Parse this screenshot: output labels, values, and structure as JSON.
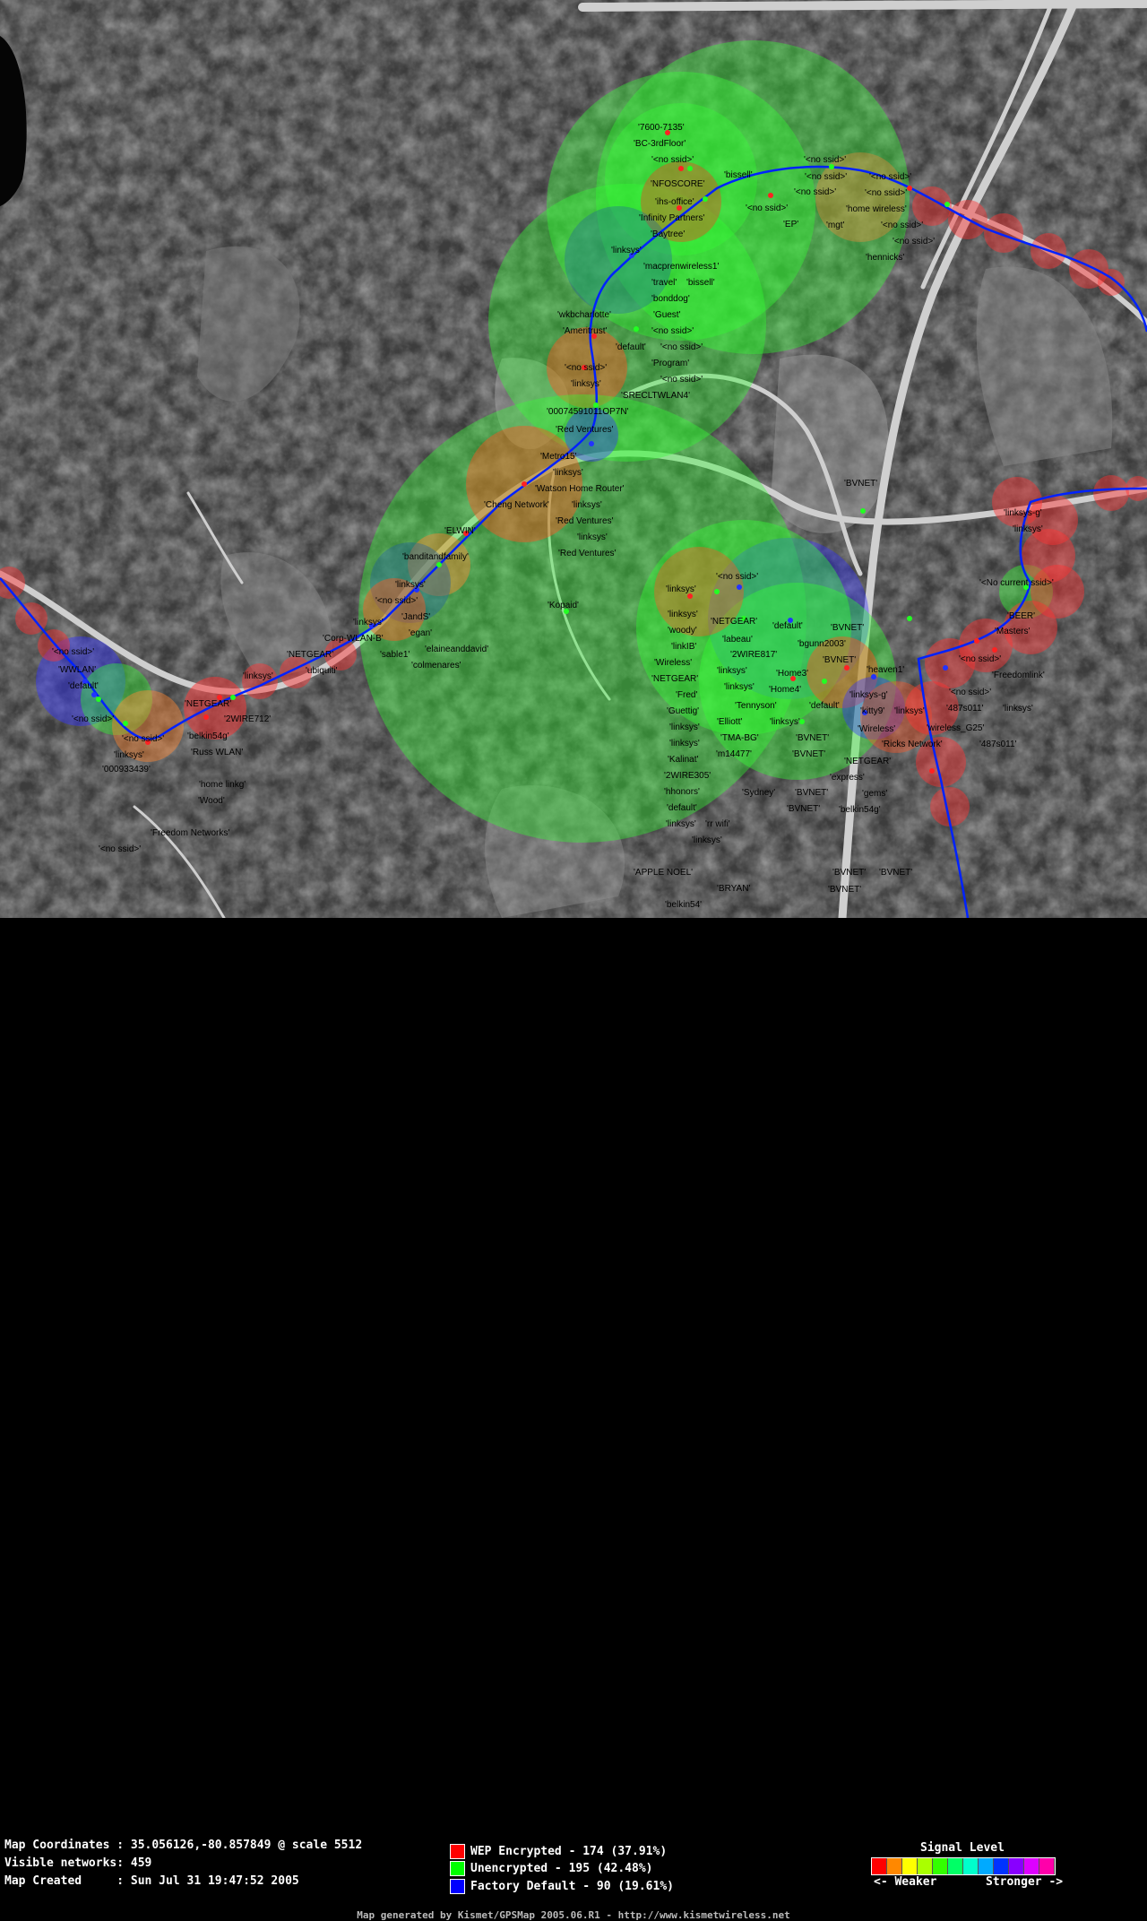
{
  "info": {
    "coordinates_label": "Map Coordinates : 35.056126,-80.857849 @ scale 5512",
    "visible_label": "Visible networks: 459",
    "created_label": "Map Created     : Sun Jul 31 19:47:52 2005"
  },
  "legend": {
    "wep": {
      "label": "WEP Encrypted - 174 (37.91%)",
      "color": "#ff0000"
    },
    "unencrypted": {
      "label": "Unencrypted - 195 (42.48%)",
      "color": "#00ff00"
    },
    "factory": {
      "label": "Factory Default - 90 (19.61%)",
      "color": "#0000ff"
    }
  },
  "signal": {
    "title": "Signal Level",
    "weaker": "<- Weaker",
    "stronger": "Stronger ->",
    "colors": [
      "#ff0000",
      "#ff8800",
      "#ffff00",
      "#aaff00",
      "#33ff00",
      "#00ff66",
      "#00ffcc",
      "#00aaff",
      "#0033ff",
      "#8800ff",
      "#dd00ff",
      "#ff00aa"
    ]
  },
  "credit": "Map generated by Kismet/GPSMap 2005.06.R1 - http://www.kismetwireless.net",
  "map": {
    "track_color": "#0022ff",
    "labels": [
      "'7600-7135'",
      "'BC-3rdFloor'",
      "'<no ssid>'",
      "'bissell'",
      "'<no ssid>'",
      "'<no ssid>'",
      "'NFOSCORE'",
      "'<no ssid>'",
      "'<no ssid>'",
      "'ihs-office'",
      "'<no ssid>'",
      "'home wireless'",
      "'Infinity Partners'",
      "'EP'",
      "'mgt'",
      "'<no ssid>'",
      "'Baytree'",
      "'<no ssid>'",
      "'linksys'",
      "'<no ssid>'",
      "'hennicks'",
      "'macprenwireless1'",
      "'travel'",
      "'bissell'",
      "'bonddog'",
      "'Guest'",
      "'wkbcharlotte'",
      "'<no ssid>'",
      "'Ameritrust'",
      "'default'",
      "'<no ssid>'",
      "'Program'",
      "'<no ssid>'",
      "'<no ssid>'",
      "'linksys'",
      "'SRECLTWLAN4'",
      "'00074591011OP7N'",
      "'Red Ventures'",
      "'Metro15'",
      "'linksys'",
      "'Watson Home Router'",
      "'Cheng Network'",
      "'linksys'",
      "'Red Ventures'",
      "'ELWIN'",
      "'linksys'",
      "'banditandfamily'",
      "'Red Ventures'",
      "'BVNET'",
      "'linksys'",
      "'<no ssid>'",
      "'Kopaid'",
      "'JandS'",
      "'egan'",
      "'linksys'",
      "'Corp-WLAN-B'",
      "'elaineanddavid'",
      "'sable1'",
      "'colmenares'",
      "'NETGEAR'",
      "'ubiquiti'",
      "'linksys'",
      "'linksys'",
      "'<no ssid>'",
      "'linksys'",
      "'NETGEAR'",
      "'default'",
      "'BVNET'",
      "'woody'",
      "'labeau'",
      "'bgunn2003'",
      "'linkIB'",
      "'2WIRE817'",
      "'BVNET'",
      "'Wireless'",
      "'linksys'",
      "'Home3'",
      "'heaven1'",
      "'NETGEAR'",
      "'linksys'",
      "'Home4'",
      "'linksys-g'",
      "'Fred'",
      "'Tennyson'",
      "'default'",
      "'kitty9'",
      "'linksys'",
      "'Guettig'",
      "'Elliott'",
      "'linksys'",
      "'Wireless'",
      "'linksys'",
      "'TMA-BG'",
      "'BVNET'",
      "'Ricks Network'",
      "'linksys'",
      "'m14477'",
      "'BVNET'",
      "'Kalinat'",
      "'NETGEAR'",
      "'2WIRE305'",
      "'express'",
      "'hhonors'",
      "'Sydney'",
      "'BVNET'",
      "'gems'",
      "'default'",
      "'BVNET'",
      "'belkin54g'",
      "'linksys'",
      "'rr wifi'",
      "'linksys'",
      "'APPLE NOEL'",
      "'BRYAN'",
      "'belkin54'",
      "'BVNET'",
      "'BVNET'",
      "'BVNET'",
      "'WWLAN'",
      "'default'",
      "'<no ssid>'",
      "'<no ssid>'",
      "'NETGEAR'",
      "'2WIRE712'",
      "'belkin54g'",
      "'Russ WLAN'",
      "'linksys'",
      "'<no ssid>'",
      "'000933439'",
      "'home linkg'",
      "'Wood'",
      "'Freedom Networks'",
      "'<no ssid>'",
      "'linksys-g'",
      "'linksys'",
      "'<No current ssid>'",
      "'BEER'",
      "'Masters'",
      "'<no ssid>'",
      "'Freedomlink'",
      "'<no ssid>'",
      "'487s011'",
      "'linksys'",
      "'wireless_G25'",
      "'487s011'"
    ]
  }
}
